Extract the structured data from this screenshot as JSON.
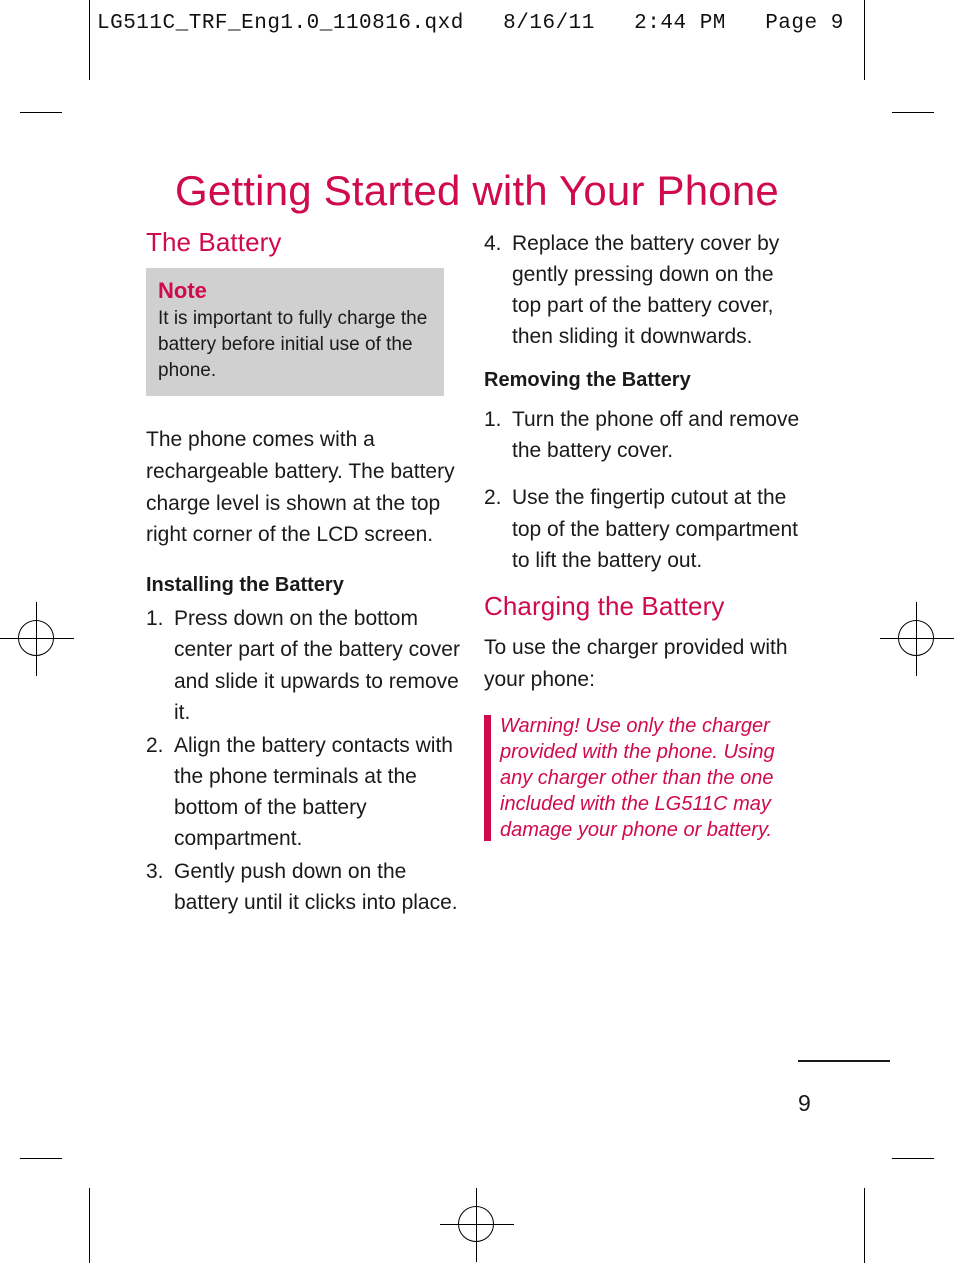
{
  "print_header": "LG511C_TRF_Eng1.0_110816.qxd   8/16/11   2:44 PM   Page 9",
  "colors": {
    "brand_pink": "#d00a4e",
    "body_text": "#1a1a1a",
    "note_background": "#d0d0d0"
  },
  "page_title": "Getting Started with Your Phone",
  "left_column": {
    "section_title": "The Battery",
    "note": {
      "label": "Note",
      "text": "It is important to fully charge the battery before initial use of the phone."
    },
    "intro_paragraph": "The phone comes with a rechargeable battery. The battery charge level is shown at the top right corner of the LCD screen.",
    "installing": {
      "heading": "Installing the Battery",
      "steps": [
        {
          "number": "1.",
          "text": "Press down on the bottom center part of the battery cover and slide it upwards to remove it."
        },
        {
          "number": "2.",
          "text": "Align the battery contacts with the phone terminals at the bottom of the battery compartment."
        },
        {
          "number": "3.",
          "text": "Gently push down on the battery until it clicks into place."
        }
      ]
    }
  },
  "right_column": {
    "continued_steps": [
      {
        "number": "4.",
        "text": "Replace the battery cover by gently pressing down on the top part of the battery cover, then sliding it downwards."
      }
    ],
    "removing": {
      "heading": "Removing the Battery",
      "steps": [
        {
          "number": "1.",
          "text": "Turn the phone off and remove the battery cover."
        },
        {
          "number": "2.",
          "text": "Use the fingertip cutout at the top of the battery compartment to lift the battery out."
        }
      ]
    },
    "charging": {
      "section_title": "Charging the Battery",
      "intro": "To use the charger provided with your phone:",
      "warning": "Warning! Use only the charger provided with the phone. Using any charger other than the one included with the LG511C may damage your phone or battery."
    }
  },
  "footer": {
    "page_number": "9"
  }
}
